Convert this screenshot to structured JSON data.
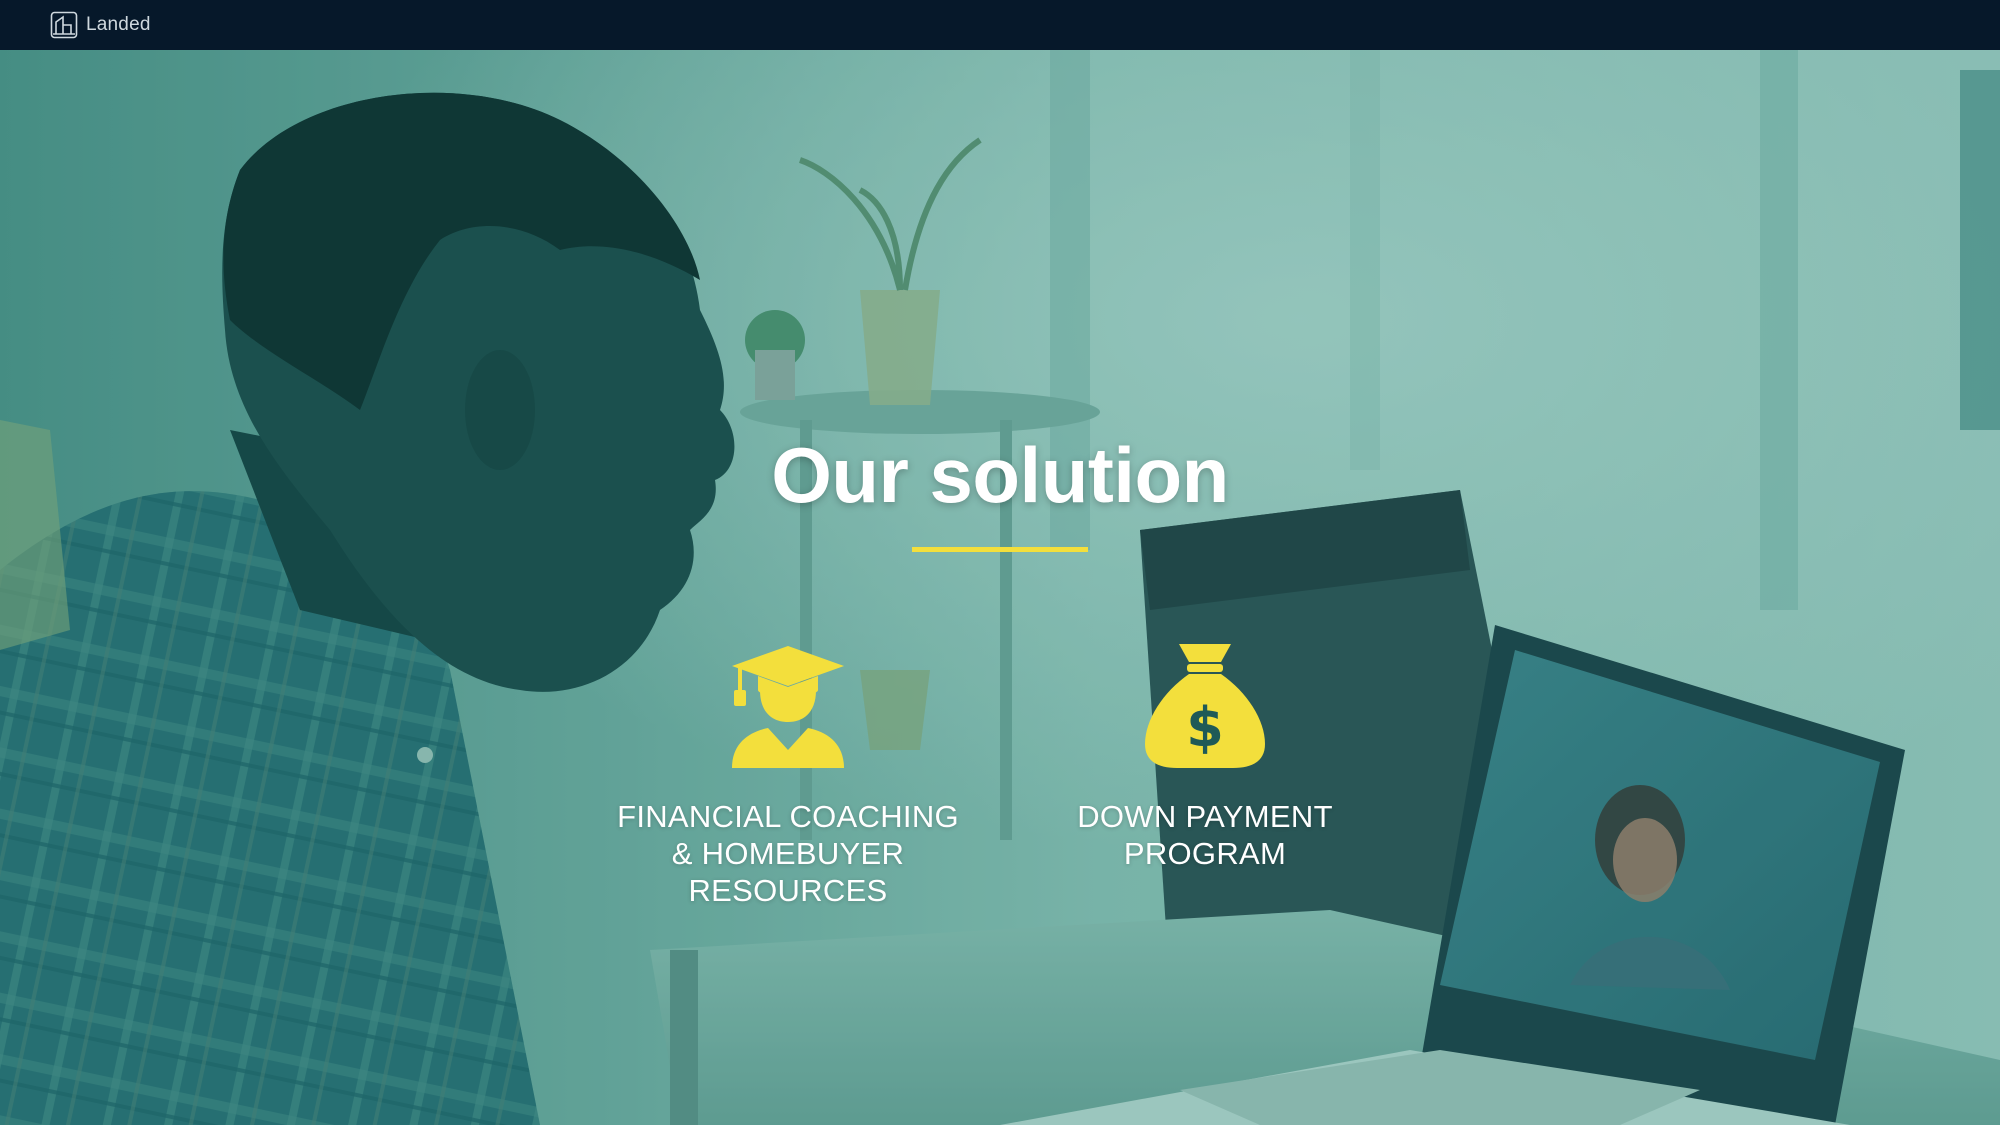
{
  "topbar": {
    "brand": "Landed",
    "logo_icon": "house-outline-icon",
    "background": "#06182a"
  },
  "hero": {
    "title": "Our solution",
    "accent_color": "#f3df3c",
    "overlay_color": "#1d8a7c"
  },
  "features": [
    {
      "icon": "graduate-icon",
      "label_lines": [
        "FINANCIAL COACHING",
        "& HOMEBUYER",
        "RESOURCES"
      ]
    },
    {
      "icon": "money-bag-dollar-icon",
      "label_lines": [
        "DOWN PAYMENT",
        "PROGRAM"
      ]
    }
  ]
}
